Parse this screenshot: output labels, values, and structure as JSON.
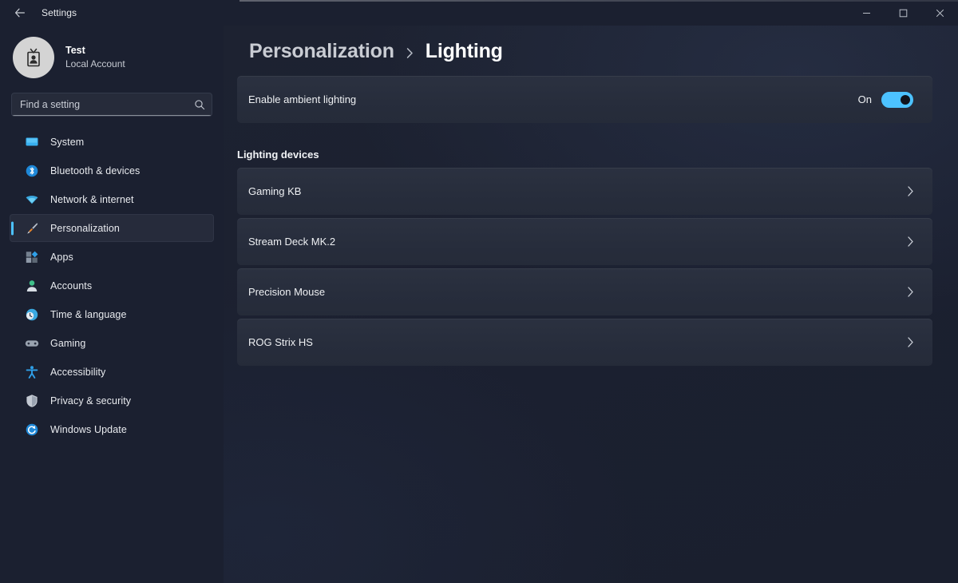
{
  "titlebar": {
    "back_icon": "back-arrow-icon",
    "title": "Settings",
    "minimize_icon": "minimize-icon",
    "maximize_icon": "maximize-icon",
    "close_icon": "close-icon"
  },
  "account": {
    "avatar_icon": "user-badge-icon",
    "name": "Test",
    "type": "Local Account"
  },
  "search": {
    "placeholder": "Find a setting",
    "value": "",
    "icon": "search-icon"
  },
  "sidebar": {
    "items": [
      {
        "label": "System",
        "icon": "system-display-icon",
        "selected": false
      },
      {
        "label": "Bluetooth & devices",
        "icon": "bluetooth-icon",
        "selected": false
      },
      {
        "label": "Network & internet",
        "icon": "wifi-icon",
        "selected": false
      },
      {
        "label": "Personalization",
        "icon": "paintbrush-icon",
        "selected": true
      },
      {
        "label": "Apps",
        "icon": "apps-icon",
        "selected": false
      },
      {
        "label": "Accounts",
        "icon": "accounts-person-icon",
        "selected": false
      },
      {
        "label": "Time & language",
        "icon": "clock-globe-icon",
        "selected": false
      },
      {
        "label": "Gaming",
        "icon": "gamepad-icon",
        "selected": false
      },
      {
        "label": "Accessibility",
        "icon": "accessibility-person-icon",
        "selected": false
      },
      {
        "label": "Privacy & security",
        "icon": "shield-icon",
        "selected": false
      },
      {
        "label": "Windows Update",
        "icon": "update-refresh-icon",
        "selected": false
      }
    ]
  },
  "breadcrumb": {
    "parent": "Personalization",
    "separator_icon": "chevron-right-icon",
    "current": "Lighting"
  },
  "ambient": {
    "label": "Enable ambient lighting",
    "state_label": "On",
    "enabled": true
  },
  "devices_section": {
    "title": "Lighting devices",
    "items": [
      {
        "name": "Gaming KB",
        "chevron_icon": "chevron-right-icon"
      },
      {
        "name": "Stream Deck MK.2",
        "chevron_icon": "chevron-right-icon"
      },
      {
        "name": "Precision Mouse",
        "chevron_icon": "chevron-right-icon"
      },
      {
        "name": "ROG Strix HS",
        "chevron_icon": "chevron-right-icon"
      }
    ]
  },
  "colors": {
    "accent": "#4cc2ff",
    "page_background": "#1b2030",
    "card_background": "#2a3040",
    "text_primary": "#eef0f3",
    "text_secondary": "#c6cad2"
  }
}
